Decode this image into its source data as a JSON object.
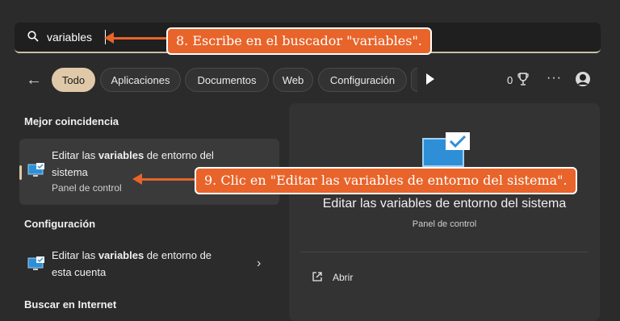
{
  "search": {
    "query": "variables"
  },
  "filters": {
    "chips": [
      "Todo",
      "Aplicaciones",
      "Documentos",
      "Web",
      "Configuración"
    ],
    "active": "Todo",
    "points": "0",
    "icons": [
      "back-arrow-icon",
      "play-icon",
      "trophy-icon",
      "more-icon",
      "avatar-icon"
    ]
  },
  "left": {
    "best_match_title": "Mejor coincidencia",
    "best_match": {
      "title_pre": "Editar las ",
      "title_bold": "variables",
      "title_post": " de entorno del",
      "title_line2": "sistema",
      "subtitle": "Panel de control"
    },
    "settings_title": "Configuración",
    "settings_item": {
      "title_pre": "Editar las ",
      "title_bold": "variables",
      "title_post": " de entorno de",
      "title_line2": "esta cuenta"
    },
    "internet_title": "Buscar en Internet"
  },
  "preview": {
    "title": "Editar las variables de entorno del sistema",
    "subtitle": "Panel de control",
    "open_label": "Abrir"
  },
  "callouts": {
    "step8": "8. Escribe en el buscador \"variables\".",
    "step9": "9. Clic en \"Editar las variables de entorno del sistema\"."
  },
  "colors": {
    "accent": "#e0c9a8",
    "callout": "#e8642a",
    "icon_blue": "#2f8fd6"
  }
}
